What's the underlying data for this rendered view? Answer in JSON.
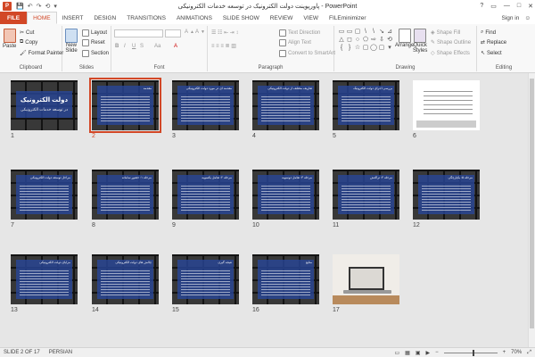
{
  "window": {
    "app_icon": "P",
    "title": "پاورپوینت دولت الکترونیک در توسعه خدمات الکترونیکی - PowerPoint",
    "controls": [
      "?",
      "▭",
      "—",
      "□",
      "✕"
    ]
  },
  "qat": [
    "💾",
    "↶",
    "↷",
    "⟲",
    "▾"
  ],
  "tabs": [
    "FILE",
    "HOME",
    "INSERT",
    "DESIGN",
    "TRANSITIONS",
    "ANIMATIONS",
    "SLIDE SHOW",
    "REVIEW",
    "VIEW",
    "FILEminimizer"
  ],
  "active_tab": "HOME",
  "signin": "Sign in",
  "ribbon": {
    "clipboard": {
      "label": "Clipboard",
      "paste": "Paste",
      "cut": "Cut",
      "copy": "Copy",
      "format_painter": "Format Painter"
    },
    "slides": {
      "label": "Slides",
      "new_slide": "New",
      "new_slide2": "Slide",
      "layout": "Layout",
      "reset": "Reset",
      "section": "Section"
    },
    "font": {
      "label": "Font",
      "bold": "B",
      "italic": "I",
      "underline": "U",
      "strike": "S",
      "case": "Aa"
    },
    "paragraph": {
      "label": "Paragraph",
      "text_direction": "Text Direction",
      "align_text": "Align Text",
      "smartart": "Convert to SmartArt"
    },
    "drawing": {
      "label": "Drawing",
      "arrange": "Arrange",
      "quick_styles": "Quick",
      "quick_styles2": "Styles",
      "shape_fill": "Shape Fill",
      "shape_outline": "Shape Outline",
      "shape_effects": "Shape Effects"
    },
    "editing": {
      "label": "Editing",
      "find": "Find",
      "replace": "Replace",
      "select": "Select"
    }
  },
  "shapes": [
    "▭",
    "▭",
    "▢",
    "\\",
    "\\",
    "↘",
    "⊿",
    "△",
    "◻",
    "○",
    "⬠",
    "⇨",
    "⇩",
    "⟲",
    "{",
    "}",
    "☆",
    "▢",
    "◯",
    "▢",
    "▾"
  ],
  "slides": [
    {
      "num": "1",
      "kind": "title",
      "big": "دولت الکترونیک",
      "sub": "در توسعه خدمات الکترونیکی"
    },
    {
      "num": "2",
      "kind": "text",
      "title": "مقدمه"
    },
    {
      "num": "3",
      "kind": "text",
      "title": "مقدمه ای در مورد دولت الکترونیکی"
    },
    {
      "num": "4",
      "kind": "text",
      "title": "تعاریف مختلف از دولت الکترونیکی"
    },
    {
      "num": "5",
      "kind": "text",
      "title": "بررسی اجرای دولت الکترونیک"
    },
    {
      "num": "6",
      "kind": "table"
    },
    {
      "num": "7",
      "kind": "text",
      "title": "مراحل توسعه دولت الکترونیکی"
    },
    {
      "num": "8",
      "kind": "text",
      "title": "مرحله ۱: حضور سامانه"
    },
    {
      "num": "9",
      "kind": "text",
      "title": "مرحله ۲: تعامل یکسویه"
    },
    {
      "num": "10",
      "kind": "text",
      "title": "مرحله ۳: تعامل دوسویه"
    },
    {
      "num": "11",
      "kind": "text",
      "title": "مرحله ۴: تراکنش"
    },
    {
      "num": "12",
      "kind": "text",
      "title": "مرحله ۵: یکپارچگی"
    },
    {
      "num": "13",
      "kind": "text",
      "title": "مزایای دولت الکترونیکی"
    },
    {
      "num": "14",
      "kind": "text",
      "title": "چالش های دولت الکترونیکی"
    },
    {
      "num": "15",
      "kind": "text",
      "title": "نتیجه گیری"
    },
    {
      "num": "16",
      "kind": "text",
      "title": "منابع"
    },
    {
      "num": "17",
      "kind": "laptop"
    }
  ],
  "selected_slide": "2",
  "status": {
    "slide": "SLIDE 2 OF 17",
    "language": "PERSIAN",
    "zoom": "70%"
  },
  "colors": {
    "accent": "#d24726"
  }
}
